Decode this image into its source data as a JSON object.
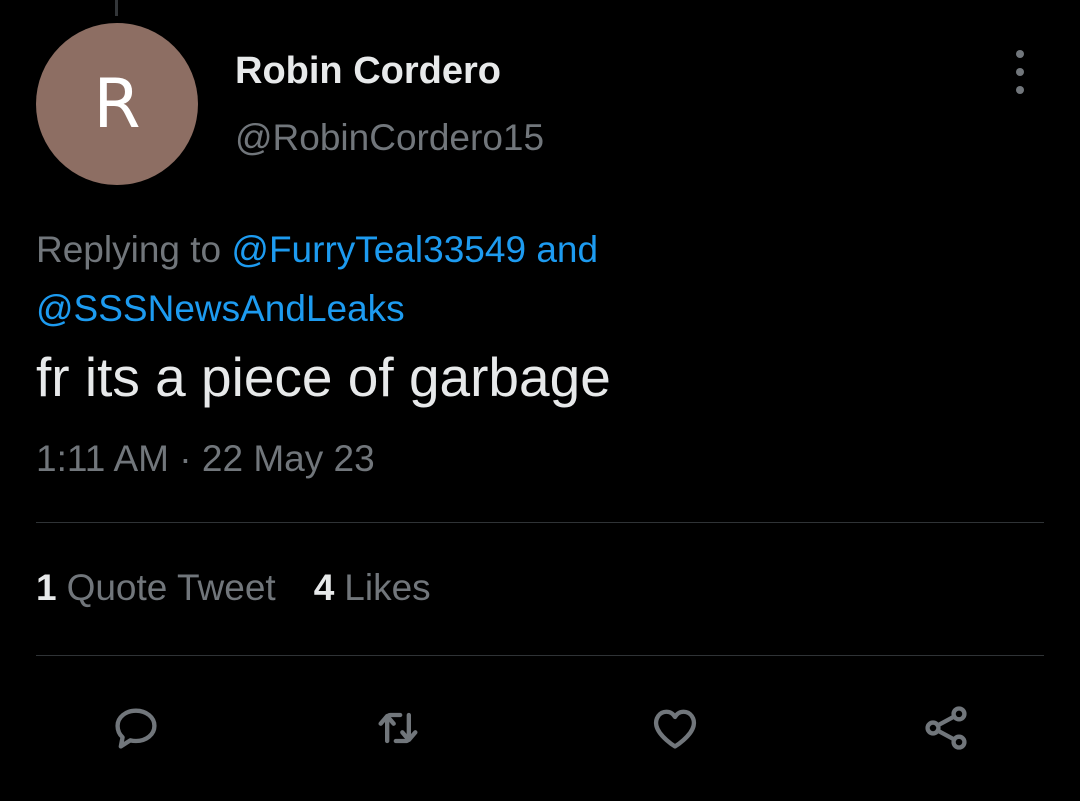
{
  "tweet": {
    "avatar_initial": "R",
    "display_name": "Robin Cordero",
    "handle": "@RobinCordero15",
    "replying_prefix": "Replying to ",
    "reply_mention_1": "@FurryTeal33549",
    "reply_joiner": " and",
    "reply_mention_2": "@SSSNewsAndLeaks",
    "text": "fr its a piece of garbage",
    "timestamp": "1:11 AM · 22 May 23"
  },
  "stats": {
    "quote_count": "1",
    "quote_label": "Quote Tweet",
    "like_count": "4",
    "like_label": "Likes"
  },
  "actions": {
    "reply_icon": "comment-bubble-icon",
    "retweet_icon": "retweet-arrows-icon",
    "like_icon": "heart-icon",
    "share_icon": "share-nodes-icon"
  },
  "colors": {
    "background": "#000000",
    "primary_text": "#e7e9ea",
    "secondary_text": "#71767b",
    "link": "#1d9bf0",
    "avatar_bg": "#8d6e63",
    "divider": "#2f3336"
  }
}
